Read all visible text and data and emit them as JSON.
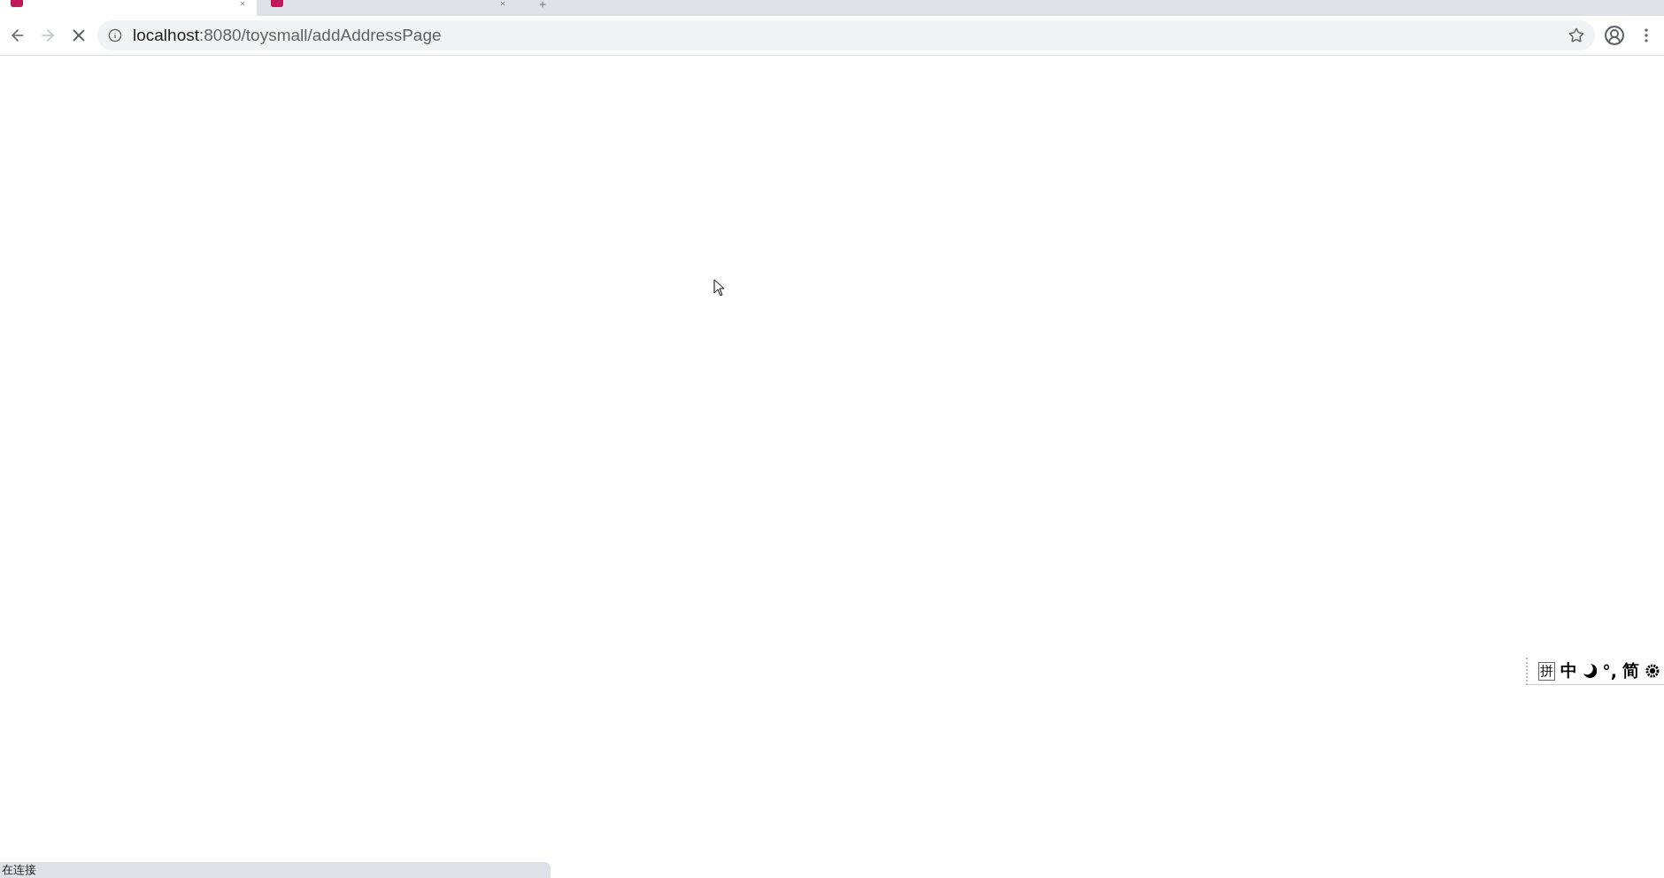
{
  "tabs": [
    {
      "selected": true
    },
    {
      "selected": false
    }
  ],
  "toolbar": {
    "loading": true,
    "url_host": "localhost",
    "url_rest": ":8080/toysmall/addAddressPage"
  },
  "ime_bar": {
    "items": [
      {
        "kind": "boxed",
        "text": "拼"
      },
      {
        "kind": "text",
        "text": "中"
      },
      {
        "kind": "moon"
      },
      {
        "kind": "text",
        "text": "°,"
      },
      {
        "kind": "text",
        "text": "简"
      },
      {
        "kind": "gear"
      }
    ]
  },
  "status_bar": {
    "text": "在连接"
  }
}
